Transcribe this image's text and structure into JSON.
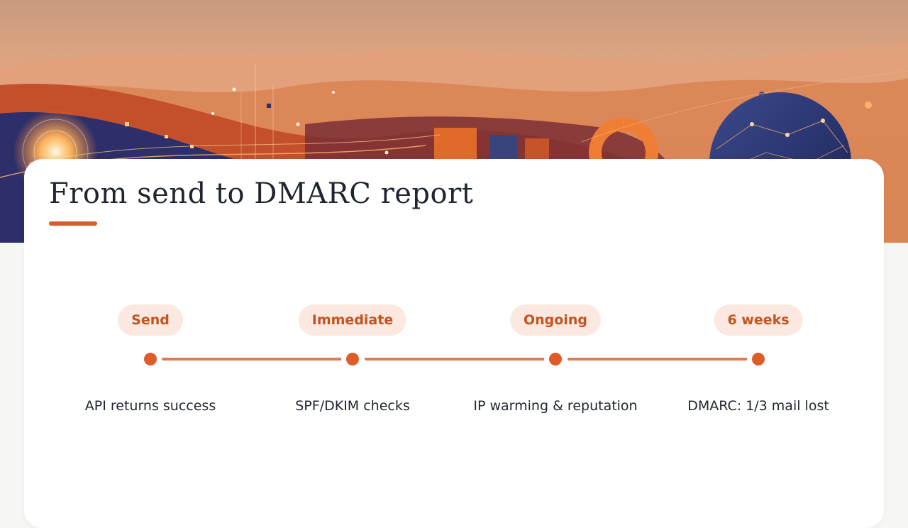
{
  "page": {
    "title": "From send to DMARC report"
  },
  "timeline": {
    "steps": [
      {
        "label": "Send",
        "caption": "API returns success"
      },
      {
        "label": "Immediate",
        "caption": "SPF/DKIM checks"
      },
      {
        "label": "Ongoing",
        "caption": "IP warming & reputation"
      },
      {
        "label": "6 weeks",
        "caption": "DMARC: 1/3 mail lost"
      }
    ]
  },
  "colors": {
    "accent": "#d65d2c",
    "pill_background": "#fbe9e1",
    "pill_text": "#c2541f",
    "connector": "#e27a4e",
    "text": "#1f2530",
    "card": "#ffffff"
  }
}
